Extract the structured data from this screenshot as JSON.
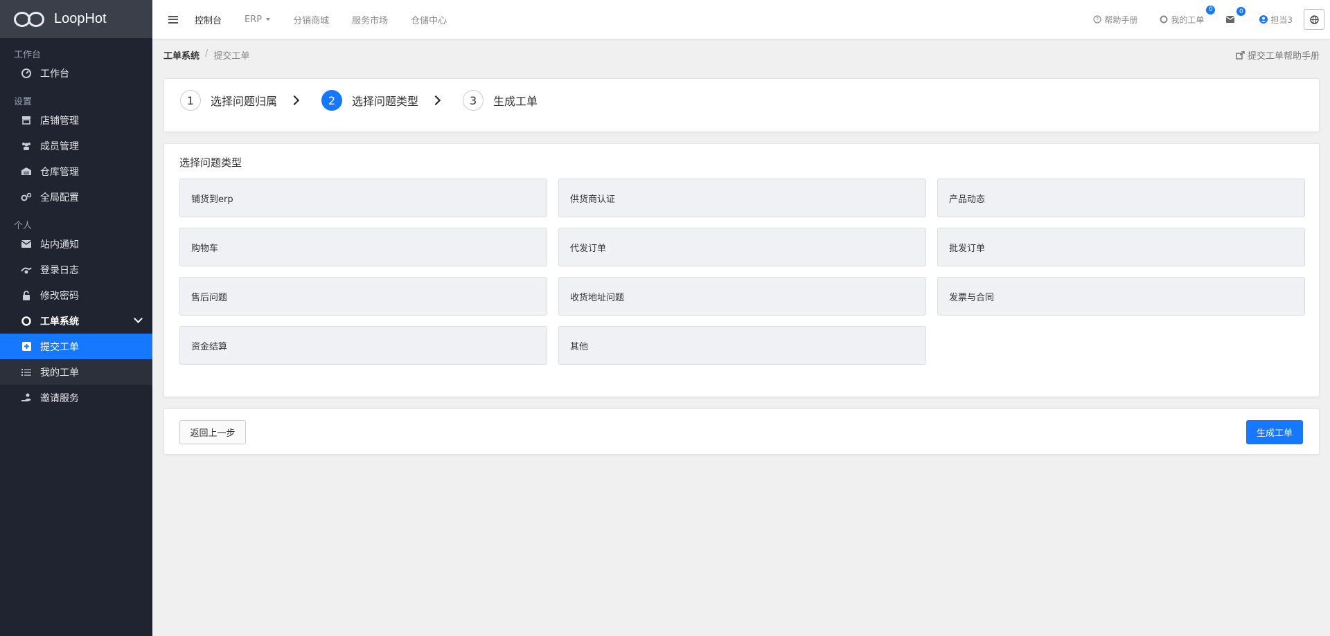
{
  "brand": {
    "name": "LoopHot"
  },
  "sidebar": {
    "sections": [
      {
        "title": "工作台",
        "items": [
          {
            "label": "工作台",
            "icon": "dashboard-icon"
          }
        ]
      },
      {
        "title": "设置",
        "items": [
          {
            "label": "店铺管理",
            "icon": "store-icon"
          },
          {
            "label": "成员管理",
            "icon": "users-icon"
          },
          {
            "label": "仓库管理",
            "icon": "warehouse-icon"
          },
          {
            "label": "全局配置",
            "icon": "cogs-icon"
          }
        ]
      },
      {
        "title": "个人",
        "items": [
          {
            "label": "站内通知",
            "icon": "envelope-icon"
          },
          {
            "label": "登录日志",
            "icon": "fingerprint-icon"
          },
          {
            "label": "修改密码",
            "icon": "lock-icon"
          },
          {
            "label": "工单系统",
            "icon": "lifebuoy-icon"
          },
          {
            "label": "提交工单",
            "icon": "plus-square-icon"
          },
          {
            "label": "我的工单",
            "icon": "list-icon"
          },
          {
            "label": "邀请服务",
            "icon": "hand-icon"
          }
        ]
      }
    ]
  },
  "topbar": {
    "nav": [
      "控制台",
      "ERP",
      "分销商城",
      "服务市场",
      "仓储中心"
    ],
    "help": "帮助手册",
    "my_tickets": "我的工单",
    "my_tickets_badge": "0",
    "mail_badge": "0",
    "user": "担当3"
  },
  "breadcrumb": {
    "root": "工单系统",
    "current": "提交工单"
  },
  "help_link": "提交工单帮助手册",
  "steps": [
    {
      "num": "1",
      "label": "选择问题归属"
    },
    {
      "num": "2",
      "label": "选择问题类型"
    },
    {
      "num": "3",
      "label": "生成工单"
    }
  ],
  "types": {
    "title": "选择问题类型",
    "options": [
      "铺货到erp",
      "供货商认证",
      "产品动态",
      "购物车",
      "代发订单",
      "批发订单",
      "售后问题",
      "收货地址问题",
      "发票与合同",
      "资金结算",
      "其他"
    ]
  },
  "actions": {
    "back": "返回上一步",
    "generate": "生成工单"
  },
  "colors": {
    "accent": "#1677ff",
    "sidebar_bg": "#1f2430"
  }
}
